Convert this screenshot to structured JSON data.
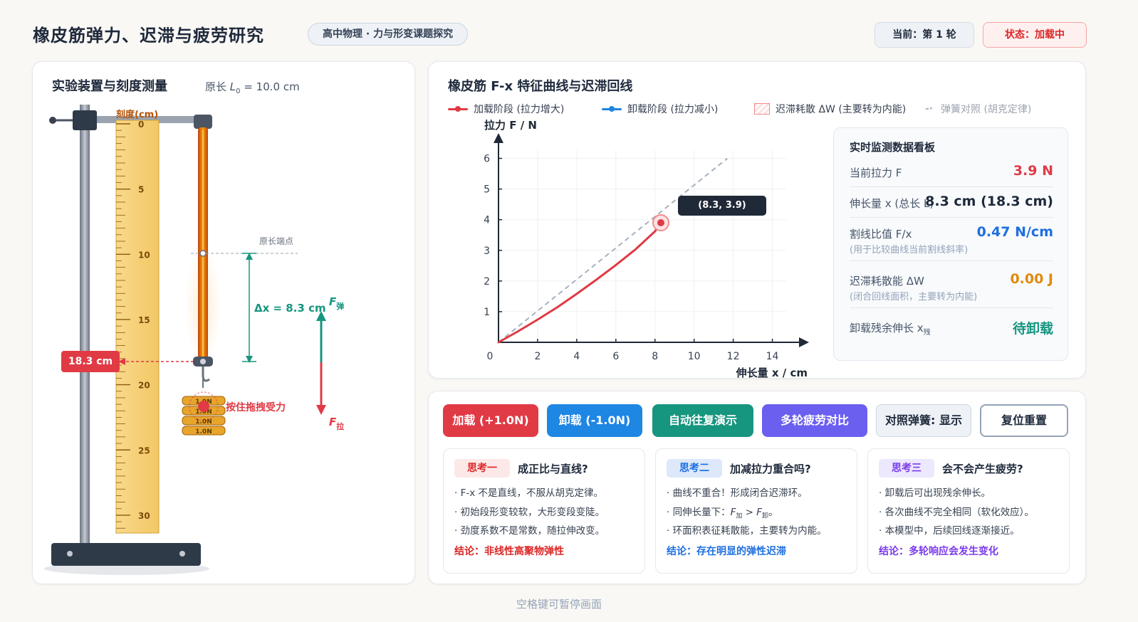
{
  "header": {
    "title": "橡皮筋弹力、迟滞与疲劳研究",
    "tag": "高中物理 · 力与形变课题探究",
    "round": "当前：第 1 轮",
    "state": "状态：加载中"
  },
  "apparatus": {
    "title": "实验装置与刻度测量",
    "original_length_prefix": "原长",
    "original_length_symbol": "L",
    "original_length_sub": "0",
    "original_length_value": "= 10.0 cm",
    "ruler_label": "刻度(cm)",
    "ruler_ticks": [
      "0",
      "5",
      "10",
      "15",
      "20",
      "25",
      "30"
    ],
    "endpoint_label": "原长端点",
    "delta_label": "Δx = 8.3 cm",
    "reading_badge": "18.3 cm",
    "force_elastic": "F",
    "force_elastic_sub": "弹",
    "force_pull": "F",
    "force_pull_sub": "拉",
    "drag_hint": "按住拖拽受力",
    "weights": [
      "1.0N",
      "1.0N",
      "1.0N",
      "1.0N"
    ]
  },
  "chart_panel": {
    "title": "橡皮筋 F-x 特征曲线与迟滞回线",
    "legend": {
      "loading": "加载阶段 (拉力增大)",
      "unloading": "卸载阶段 (拉力减小)",
      "hysteresis": "迟滞耗散 ΔW (主要转为内能)",
      "spring": "弹簧对照 (胡克定律)"
    },
    "colors": {
      "loading": "#e03a45",
      "unloading": "#1e86e3",
      "spring": "#a8b1bf",
      "hysteresis": "#f28b8b"
    },
    "tooltip": "(8.3, 3.9)"
  },
  "chart_data": {
    "type": "line",
    "xlabel": "伸长量 x / cm",
    "ylabel": "拉力 F / N",
    "xlim": [
      0,
      15
    ],
    "ylim": [
      0,
      6.5
    ],
    "xticks": [
      0,
      2,
      4,
      6,
      8,
      10,
      12,
      14
    ],
    "yticks": [
      1,
      2,
      3,
      4,
      5,
      6
    ],
    "grid": true,
    "series": [
      {
        "name": "加载阶段 (拉力增大)",
        "x": [
          0,
          1,
          2,
          3,
          4,
          5,
          6,
          7,
          8,
          8.3
        ],
        "y": [
          0,
          0.36,
          0.74,
          1.14,
          1.58,
          2.04,
          2.52,
          3.03,
          3.62,
          3.9
        ]
      },
      {
        "name": "弹簧对照 (胡克定律)",
        "x": [
          0,
          11.7
        ],
        "y": [
          0,
          6.0
        ]
      }
    ],
    "current_point": {
      "x": 8.3,
      "y": 3.9
    }
  },
  "monitor": {
    "title": "实时监测数据看板",
    "force_label": "当前拉力 F",
    "force_value": "3.9 N",
    "ext_label": "伸长量 x (总长 L)",
    "ext_value": "8.3 cm (18.3 cm)",
    "ratio_label": "割线比值 F/x",
    "ratio_hint": "(用于比较曲线当前割线斜率)",
    "ratio_value": "0.47 N/cm",
    "energy_label": "迟滞耗散能 ΔW",
    "energy_hint": "(闭合回线面积，主要转为内能)",
    "energy_value": "0.00 J",
    "residual_label": "卸载残余伸长 x",
    "residual_sub": "残",
    "residual_value": "待卸载"
  },
  "controls": {
    "load": "加载 (+1.0N)",
    "unload": "卸载 (-1.0N)",
    "auto": "自动往复演示",
    "fatigue": "多轮疲劳对比",
    "ref_spring": "对照弹簧: 显示",
    "reset": "复位重置"
  },
  "cards": [
    {
      "badge": "思考一",
      "question": "成正比与直线?",
      "items": [
        "· F-x 不是直线，不服从胡克定律。",
        "· 初始段形变较软，大形变段变陡。",
        "· 劲度系数不是常数，随拉伸改变。"
      ],
      "conclusion": "结论：非线性高聚物弹性"
    },
    {
      "badge": "思考二",
      "question": "加减拉力重合吗?",
      "items": [
        "· 曲线不重合！形成闭合迟滞环。",
        "· 同伸长量下：",
        "· 环面积表征耗散能，主要转为内能。"
      ],
      "item2_tail": {
        "f1": "F",
        "s1": "加",
        "gt": " > ",
        "f2": "F",
        "s2": "卸",
        "end": "。"
      },
      "conclusion": "结论：存在明显的弹性迟滞"
    },
    {
      "badge": "思考三",
      "question": "会不会产生疲劳?",
      "items": [
        "· 卸载后可出现残余伸长。",
        "· 各次曲线不完全相同（软化效应）。",
        "· 本模型中，后续回线逐渐接近。"
      ],
      "conclusion": "结论：多轮响应会发生变化"
    }
  ],
  "footer": "空格键可暂停画面"
}
